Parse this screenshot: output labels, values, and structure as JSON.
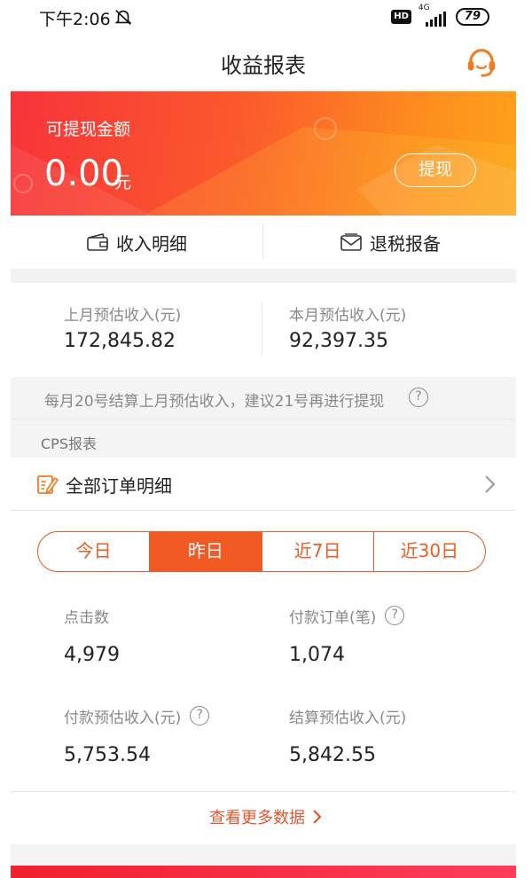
{
  "status_bar": {
    "time": "下午2:06",
    "hd": "HD",
    "network": "4G",
    "battery": "79"
  },
  "header": {
    "title": "收益报表",
    "support_icon": "headset-icon"
  },
  "balance": {
    "label": "可提现金额",
    "amount": "0.00",
    "unit": "元",
    "withdraw_label": "提现"
  },
  "quick_actions": {
    "income_detail": "收入明细",
    "tax_filing": "退税报备"
  },
  "estimates": {
    "last_month_label": "上月预估收入(元)",
    "last_month_value": "172,845.82",
    "this_month_label": "本月预估收入(元)",
    "this_month_value": "92,397.35"
  },
  "notice": "每月20号结算上月预估收入，建议21号再进行提现",
  "help_mark": "?",
  "cps": {
    "section_title": "CPS报表",
    "all_orders": "全部订单明细",
    "tabs": [
      {
        "label": "今日",
        "active": false
      },
      {
        "label": "昨日",
        "active": true
      },
      {
        "label": "近7日",
        "active": false
      },
      {
        "label": "近30日",
        "active": false
      }
    ],
    "stats": {
      "clicks_label": "点击数",
      "clicks_value": "4,979",
      "paid_orders_label": "付款订单(笔)",
      "paid_orders_value": "1,074",
      "paid_income_label": "付款预估收入(元)",
      "paid_income_value": "5,753.54",
      "settled_income_label": "结算预估收入(元)",
      "settled_income_value": "5,842.55"
    },
    "more_label": "查看更多数据"
  },
  "colors": {
    "accent": "#f15a22",
    "banner_start": "#f7333a",
    "banner_end": "#fda21b"
  }
}
